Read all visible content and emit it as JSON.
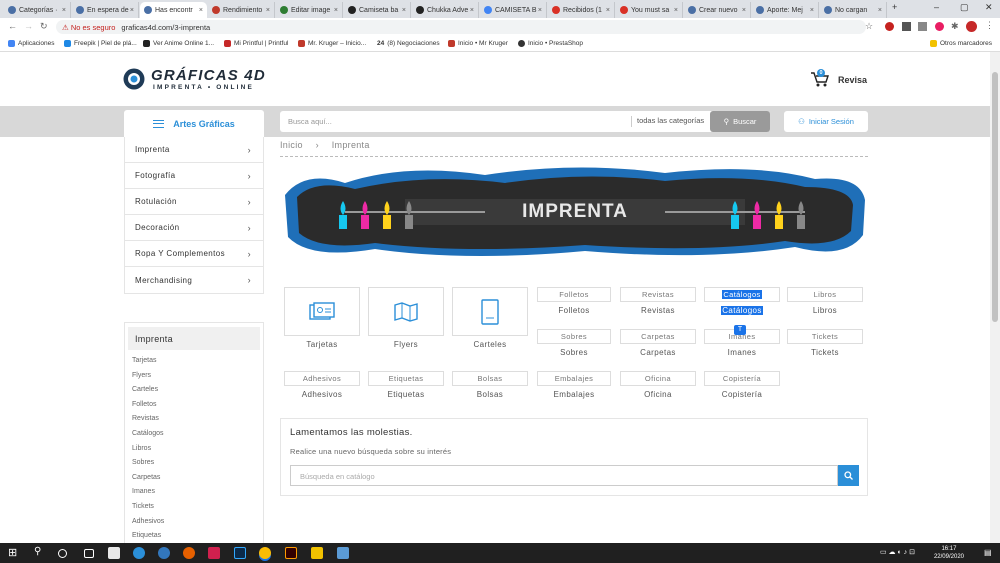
{
  "browser": {
    "tabs": [
      "Categorías ·",
      "En espera de",
      "Has encontr",
      "Rendimiento",
      "Editar image",
      "Camiseta ba",
      "Chukka Adve",
      "CAMISETA B",
      "Recibidos (1",
      "You must sa",
      "Crear nuevo",
      "Aporte: Mej",
      "No cargan"
    ],
    "active_tab": 2,
    "security_warning": "No es seguro",
    "url": "graficas4d.com/3-imprenta",
    "bookmarks": [
      "Aplicaciones",
      "Freepik | Piel de plá...",
      "Ver Anime Online 1...",
      "Mi Printful | Printful",
      "Mr. Kruger – Inicio...",
      "(8) Negociaciones",
      "Inicio • Mr Kruger",
      "Inicio • PrestaShop"
    ],
    "bookmark_24": "24",
    "other_bookmarks": "Otros marcadores"
  },
  "header": {
    "logo_title": "GRÁFICAS 4D",
    "logo_subtitle": "IMPRENTA • ONLINE",
    "cart_label": "Revisa",
    "cart_count": "0"
  },
  "nav": {
    "artes_label": "Artes Gráficas",
    "search_placeholder": "Busca aquí...",
    "category_select": "todas las categorías",
    "search_button": "Buscar",
    "login_label": "Iniciar Sesión"
  },
  "menu": [
    "Imprenta",
    "Fotografía",
    "Rotulación",
    "Decoración",
    "Ropa Y Complementos",
    "Merchandising"
  ],
  "sidebar": {
    "heading": "Imprenta",
    "items": [
      "Tarjetas",
      "Flyers",
      "Carteles",
      "Folletos",
      "Revistas",
      "Catálogos",
      "Libros",
      "Sobres",
      "Carpetas",
      "Imanes",
      "Tickets",
      "Adhesivos",
      "Etiquetas"
    ]
  },
  "breadcrumb": {
    "home": "Inicio",
    "sep": "›",
    "current": "Imprenta"
  },
  "banner_text": "IMPRENTA",
  "categories_row1_big": [
    "Tarjetas",
    "Flyers",
    "Carteles"
  ],
  "categories_row1_small": [
    "Folletos",
    "Revistas",
    "Catálogos",
    "Libros"
  ],
  "categories_row2": [
    "Sobres",
    "Carpetas",
    "Imanes",
    "Tickets"
  ],
  "categories_row3": [
    "Adhesivos",
    "Etiquetas",
    "Bolsas",
    "Embalajes",
    "Oficina",
    "Copistería"
  ],
  "notice": {
    "title": "Lamentamos las molestias.",
    "subtitle": "Realice una nuevo búsqueda sobre su interés",
    "search_placeholder": "Búsqueda en catálogo"
  },
  "taskbar": {
    "time": "16:17",
    "date": "22/09/2020"
  }
}
